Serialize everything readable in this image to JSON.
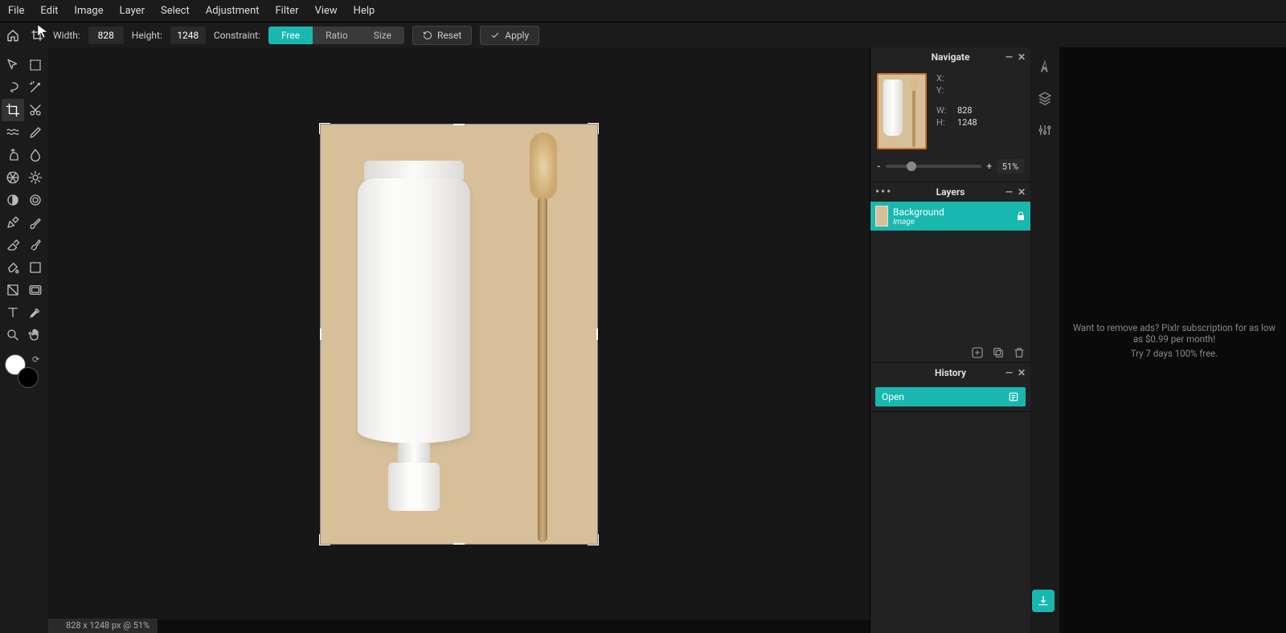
{
  "menu": [
    "File",
    "Edit",
    "Image",
    "Layer",
    "Select",
    "Adjustment",
    "Filter",
    "View",
    "Help"
  ],
  "options": {
    "width_label": "Width:",
    "width_value": "828",
    "height_label": "Height:",
    "height_value": "1248",
    "constraint_label": "Constraint:",
    "btn_free": "Free",
    "btn_ratio": "Ratio",
    "btn_size": "Size",
    "reset": "Reset",
    "apply": "Apply"
  },
  "nav": {
    "title": "Navigate",
    "x": "X:",
    "y": "Y:",
    "w": "W:",
    "h": "H:",
    "w_val": "828",
    "h_val": "1248",
    "zoom_pct": "51%",
    "minus": "-",
    "plus": "+"
  },
  "layers": {
    "title": "Layers",
    "layer_name": "Background",
    "layer_type": "Image"
  },
  "history": {
    "title": "History",
    "item": "Open"
  },
  "status": "828 x 1248 px @ 51%",
  "ad": {
    "l1": "Want to remove ads? Pixlr subscription for as low as $0.99 per month!",
    "l2": "Try 7 days 100% free."
  },
  "tools": [
    [
      "arrow",
      "marquee"
    ],
    [
      "lasso",
      "wand"
    ],
    [
      "crop",
      "cut"
    ],
    [
      "liquify",
      "pencil"
    ],
    [
      "clone",
      "blur"
    ],
    [
      "heal",
      "sun"
    ],
    [
      "dodge",
      "sharpen"
    ],
    [
      "pen",
      "brush"
    ],
    [
      "eraser",
      "smudge"
    ],
    [
      "fill",
      "gradient"
    ],
    [
      "shape",
      "frame"
    ],
    [
      "text",
      "picker"
    ],
    [
      "zoom",
      "hand"
    ]
  ],
  "active_tool": "crop"
}
